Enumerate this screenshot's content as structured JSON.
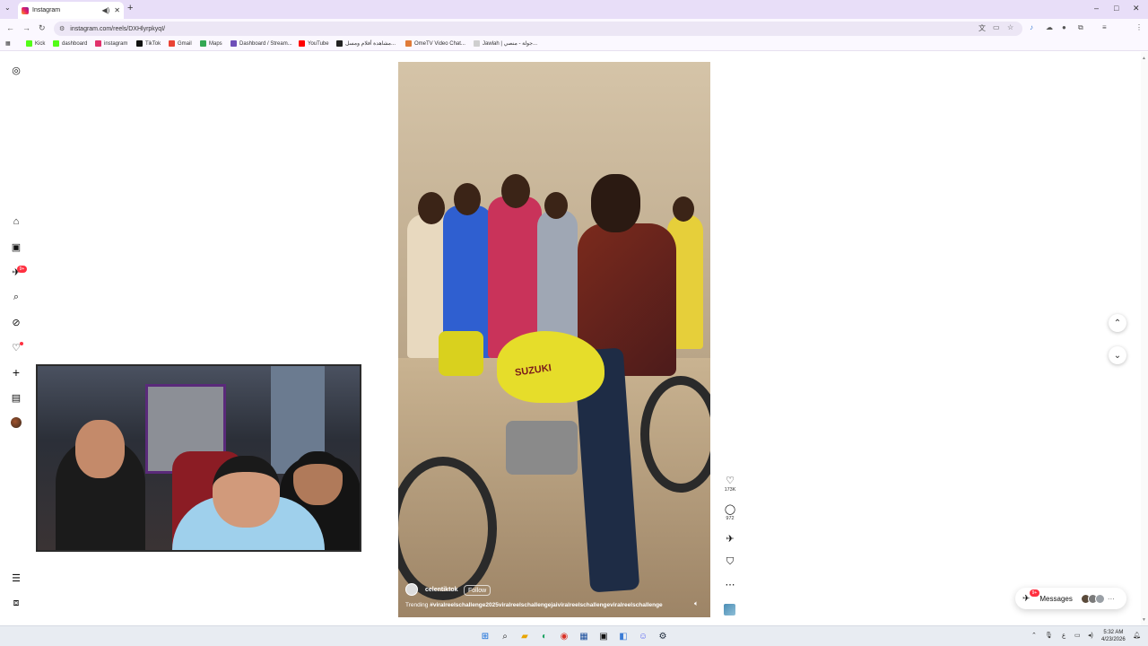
{
  "browser": {
    "tab_title": "Instagram",
    "new_tab": "+",
    "url": "instagram.com/reels/DXHlyrpkyqI/",
    "window_controls": [
      "–",
      "□",
      "✕"
    ],
    "bookmarks": [
      {
        "label": "Kick",
        "color": "#53fc18"
      },
      {
        "label": "dashboard",
        "color": "#53fc18"
      },
      {
        "label": "instagram",
        "color": "#e1306c"
      },
      {
        "label": "TikTok",
        "color": "#111111"
      },
      {
        "label": "Gmail",
        "color": "#ea4335"
      },
      {
        "label": "Maps",
        "color": "#34a853"
      },
      {
        "label": "Dashboard / Stream...",
        "color": "#6f4fb8"
      },
      {
        "label": "YouTube",
        "color": "#ff0000"
      },
      {
        "label": "مشاهدة أفلام ومسل...",
        "color": "#222222"
      },
      {
        "label": "OmeTV Video Chat...",
        "color": "#e07b39"
      },
      {
        "label": "Jawlah | جولة - منصي...",
        "color": "#cfcfcf"
      }
    ]
  },
  "instagram": {
    "sidebar": {
      "notification_badge": "9+",
      "icons": [
        "instagram-logo-icon",
        "home-icon",
        "reels-icon",
        "messages-icon",
        "search-icon",
        "explore-icon",
        "notifications-icon",
        "create-icon",
        "dashboard-icon",
        "profile-avatar",
        "menu-icon",
        "also-from-meta-icon"
      ]
    },
    "reel": {
      "username": "celentiktok",
      "follow_label": "Follow",
      "caption_prefix": "Trending",
      "caption_tags": "#viralreelschallenge2025viralreelschallengejaiviralreelschallengeviralreelschallenge",
      "tank_text": "SUZUKI"
    },
    "actions": {
      "likes": "173K",
      "comments": "972"
    },
    "messages": {
      "label": "Messages",
      "badge": "9+"
    }
  },
  "taskbar": {
    "time": "5:32 AM",
    "date": "4/23/2026",
    "lang": "ع"
  }
}
